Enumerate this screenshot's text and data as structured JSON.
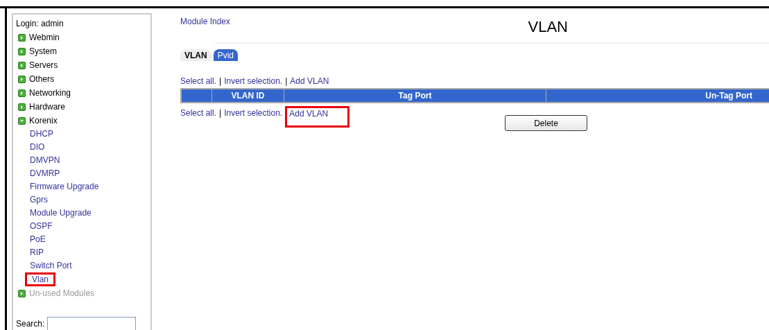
{
  "sidebar": {
    "login": "Login: admin",
    "categories": [
      {
        "label": "Webmin",
        "expanded": false,
        "muted": false
      },
      {
        "label": "System",
        "expanded": false,
        "muted": false
      },
      {
        "label": "Servers",
        "expanded": false,
        "muted": false
      },
      {
        "label": "Others",
        "expanded": false,
        "muted": false
      },
      {
        "label": "Networking",
        "expanded": false,
        "muted": false
      },
      {
        "label": "Hardware",
        "expanded": false,
        "muted": false
      },
      {
        "label": "Korenix",
        "expanded": true,
        "muted": false,
        "children": [
          {
            "label": "DHCP",
            "highlighted": false
          },
          {
            "label": "DIO",
            "highlighted": false
          },
          {
            "label": "DMVPN",
            "highlighted": false
          },
          {
            "label": "DVMRP",
            "highlighted": false
          },
          {
            "label": "Firmware Upgrade",
            "highlighted": false
          },
          {
            "label": "Gprs",
            "highlighted": false
          },
          {
            "label": "Module Upgrade",
            "highlighted": false
          },
          {
            "label": "OSPF",
            "highlighted": false
          },
          {
            "label": "PoE",
            "highlighted": false
          },
          {
            "label": "RIP",
            "highlighted": false
          },
          {
            "label": "Switch Port",
            "highlighted": false
          },
          {
            "label": "Vlan",
            "highlighted": true
          }
        ]
      },
      {
        "label": "Un-used Modules",
        "expanded": false,
        "muted": true
      }
    ],
    "search": {
      "label": "Search:"
    }
  },
  "main": {
    "module_index": "Module Index",
    "title": "VLAN",
    "tabs": [
      {
        "label": "VLAN",
        "selected": true
      },
      {
        "label": "Pvid",
        "selected": false
      }
    ],
    "top_links": [
      {
        "label": "Select all.",
        "highlighted": false
      },
      {
        "label": "Invert selection.",
        "highlighted": false
      },
      {
        "label": "Add VLAN",
        "highlighted": false
      }
    ],
    "table": {
      "columns": [
        "VLAN ID",
        "Tag Port",
        "Un-Tag Port"
      ]
    },
    "bottom_links": [
      {
        "label": "Select all.",
        "highlighted": false
      },
      {
        "label": "Invert selection.",
        "highlighted": false
      },
      {
        "label": "Add VLAN",
        "highlighted": true
      }
    ],
    "separator": "|",
    "delete_button": "Delete"
  }
}
